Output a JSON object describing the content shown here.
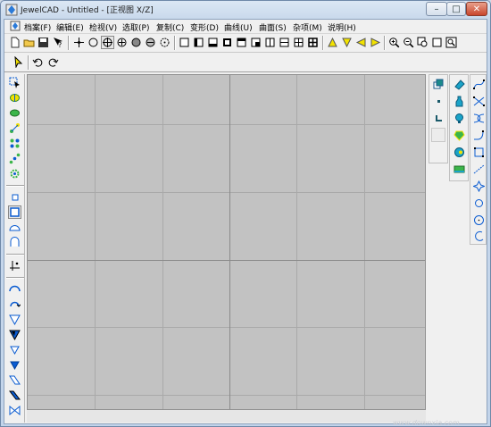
{
  "window": {
    "title": "JewelCAD - Untitled - [正视图 X/Z]",
    "minimize_label": "–",
    "maximize_label": "□",
    "close_label": "✕"
  },
  "menubar": {
    "items": [
      {
        "label": "档案(F)"
      },
      {
        "label": "编辑(E)"
      },
      {
        "label": "检视(V)"
      },
      {
        "label": "选取(P)"
      },
      {
        "label": "复制(C)"
      },
      {
        "label": "变形(D)"
      },
      {
        "label": "曲线(U)"
      },
      {
        "label": "曲面(S)"
      },
      {
        "label": "杂项(M)"
      },
      {
        "label": "说明(H)"
      }
    ]
  },
  "toolbar": {
    "icons": [
      "new-file-icon",
      "open-folder-icon",
      "save-icon",
      "help-cursor-icon",
      "point-cross-icon",
      "circle-icon",
      "circle-cross-icon",
      "circle-plus-icon",
      "filled-circle-icon",
      "circle-minus-icon",
      "circle-dotted-icon",
      "square-icon",
      "square-left-icon",
      "square-bottom-icon",
      "square-filled-icon",
      "square-top-icon",
      "square-corner-icon",
      "rect-v-split-icon",
      "rect-h-split-icon",
      "grid-icon",
      "grid-bold-icon",
      "triangle-up-icon",
      "triangle-down-icon",
      "triangle-left-icon",
      "triangle-right-icon",
      "zoom-in-icon",
      "zoom-out-icon",
      "zoom-window-icon",
      "zoom-frame-icon",
      "zoom-fit-icon"
    ]
  },
  "toolbar2": {
    "icons": [
      "pointer-icon",
      "undo-icon",
      "redo-icon"
    ]
  },
  "left_toolbar": {
    "icons": [
      "select-pick-icon",
      "align-ellipse-icon",
      "ellipse-icon",
      "nodes-icon",
      "multi-dot-icon",
      "diagonal-dots-icon",
      "gear-icon",
      "small-rect-icon",
      "rect-outline-icon",
      "dome-icon",
      "arch-icon",
      "axis-point-icon",
      "arc-icon",
      "arch-arrow-icon",
      "triangle-down-outline-icon",
      "triangle-down-filled-icon",
      "triangle-down-small-icon",
      "triangle-down-blue-icon",
      "parallelogram-icon",
      "slant-bar-icon",
      "bowtie-icon"
    ]
  },
  "right_panel_1": {
    "icons": [
      "copy-frame-icon",
      "dot-icon",
      "corner-icon",
      "blank-icon"
    ]
  },
  "right_panel_2": {
    "icons": [
      "eraser-icon",
      "bottle-icon",
      "bulb-icon",
      "gem-icon",
      "disc-icon",
      "ring-icon"
    ]
  },
  "right_panel_3": {
    "icons": [
      "curve-nodes-icon",
      "curve-swap-icon",
      "curve-loop-icon",
      "curve-bend-icon",
      "curve-frame-icon",
      "curve-line-icon",
      "curve-star-icon",
      "circle-outline-icon",
      "circle-large-icon",
      "arc-curve-icon"
    ]
  },
  "watermark": "www.downxia.com",
  "colors": {
    "viewport": "#c2c2c2",
    "grid_line": "#a8a8a8",
    "axis_line": "#8a8a8a",
    "accent": "#0a5bd1"
  }
}
